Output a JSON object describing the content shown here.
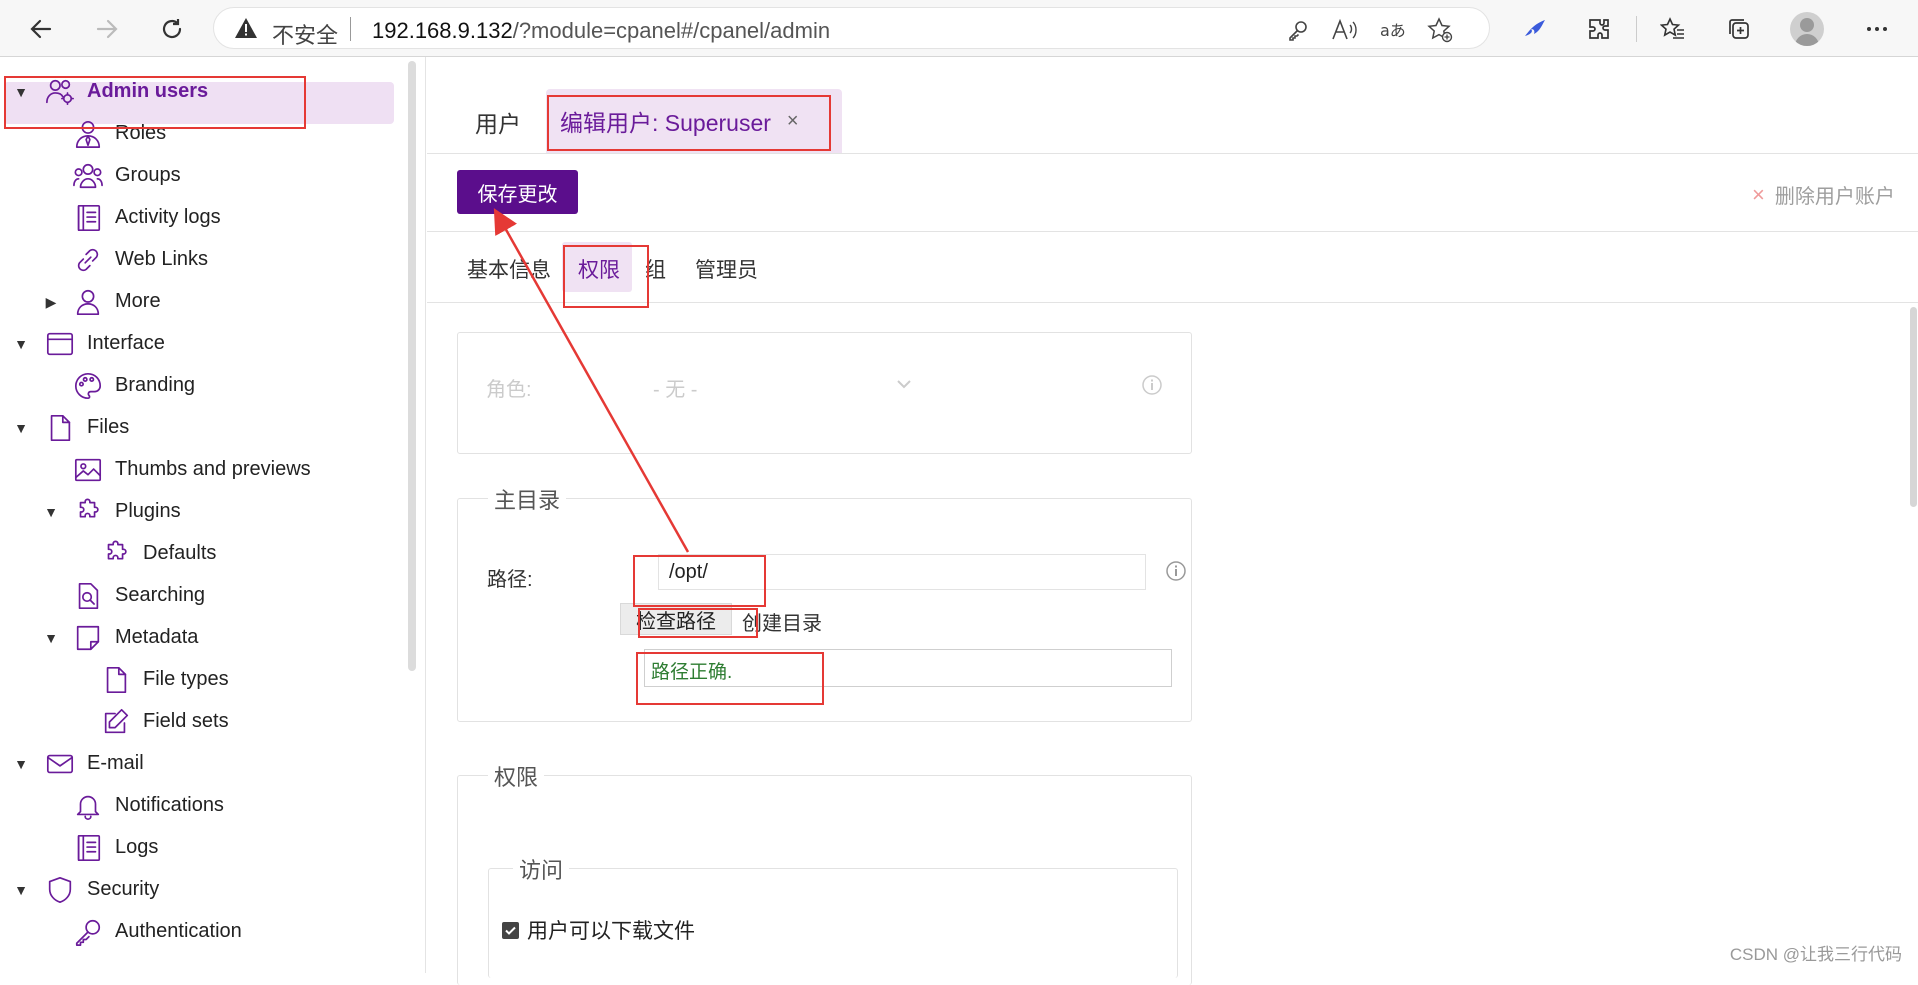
{
  "browser": {
    "insecure_label": "不安全",
    "url_host": "192.168.9.132",
    "url_path": "/?module=cpanel#/cpanel/admin"
  },
  "sidebar": {
    "active": "Admin users",
    "items": [
      {
        "label": "Admin users",
        "icon": "users-gear-icon"
      },
      {
        "label": "Roles",
        "icon": "user-tie-icon"
      },
      {
        "label": "Groups",
        "icon": "group-icon"
      },
      {
        "label": "Activity logs",
        "icon": "log-book-icon"
      },
      {
        "label": "Web Links",
        "icon": "link-icon"
      },
      {
        "label": "More",
        "icon": "user-icon"
      },
      {
        "label": "Interface",
        "icon": "window-icon"
      },
      {
        "label": "Branding",
        "icon": "palette-icon"
      },
      {
        "label": "Files",
        "icon": "file-icon"
      },
      {
        "label": "Thumbs and previews",
        "icon": "image-icon"
      },
      {
        "label": "Plugins",
        "icon": "puzzle-icon"
      },
      {
        "label": "Defaults",
        "icon": "puzzle-icon"
      },
      {
        "label": "Searching",
        "icon": "file-search-icon"
      },
      {
        "label": "Metadata",
        "icon": "note-icon"
      },
      {
        "label": "File types",
        "icon": "file-icon"
      },
      {
        "label": "Field sets",
        "icon": "edit-icon"
      },
      {
        "label": "E-mail",
        "icon": "mail-icon"
      },
      {
        "label": "Notifications",
        "icon": "bell-icon"
      },
      {
        "label": "Logs",
        "icon": "log-book-icon"
      },
      {
        "label": "Security",
        "icon": "shield-icon"
      },
      {
        "label": "Authentication",
        "icon": "key-icon"
      }
    ]
  },
  "tabs": {
    "users": "用户",
    "edit": "编辑用户: Superuser",
    "close": "×"
  },
  "toolbar": {
    "save": "保存更改",
    "delete": "删除用户账户",
    "delete_x": "×"
  },
  "subtabs": [
    "基本信息",
    "权限",
    "组",
    "管理员"
  ],
  "role": {
    "label": "角色:",
    "value": "- 无 -"
  },
  "home": {
    "legend": "主目录",
    "path_label": "路径:",
    "path_value": "/opt/",
    "check_button": "检查路径",
    "create_dir": "创建目录",
    "result": "路径正确."
  },
  "permissions": {
    "legend": "权限",
    "access_legend": "访问",
    "download_label": "用户可以下载文件",
    "download_checked": true
  },
  "watermark": "CSDN @让我三行代码"
}
